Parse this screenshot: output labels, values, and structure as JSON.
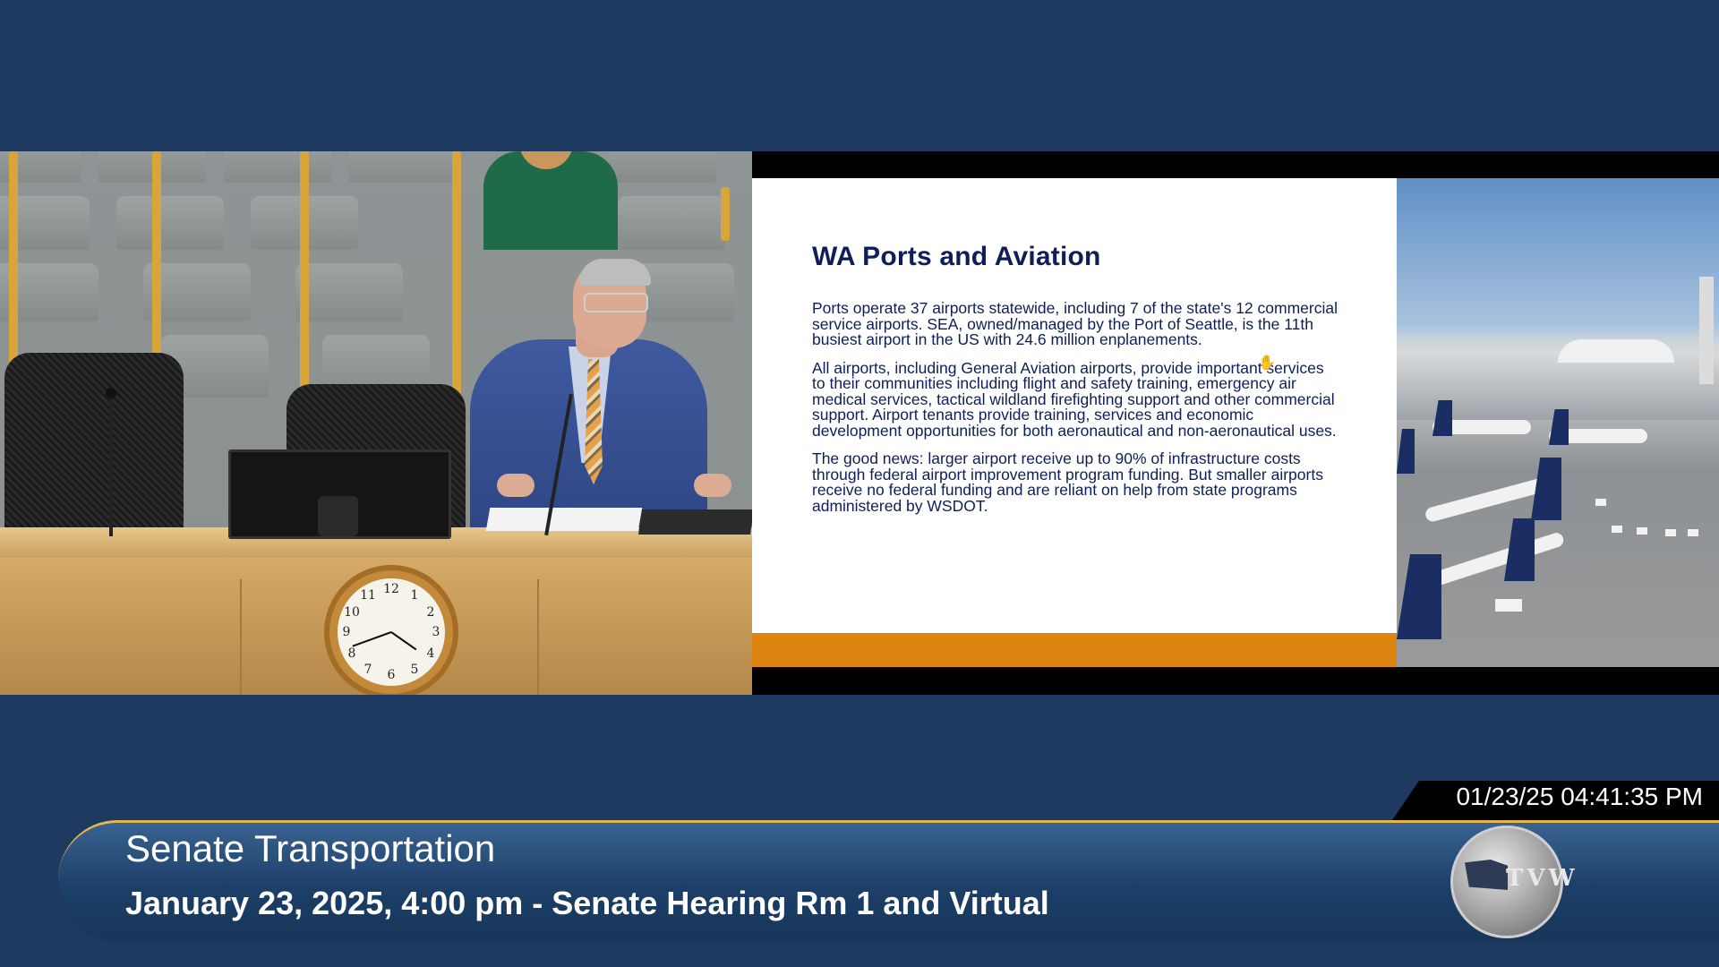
{
  "slide": {
    "title": "WA Ports and Aviation",
    "paragraphs": [
      "Ports operate 37 airports statewide, including 7 of the state's 12 commercial service airports. SEA, owned/managed by the Port of Seattle, is the 11th busiest airport in the US with 24.6 million enplanements.",
      "All airports, including General Aviation airports, provide important services to their communities including flight and safety training, emergency air medical services, tactical wildland firefighting support and other commercial support. Airport tenants provide training, services and economic development opportunities for both aeronautical and non-aeronautical uses.",
      "The good news: larger airport receive up to 90% of infrastructure costs through federal airport improvement program funding. But smaller airports receive no federal funding and are reliant on help from state programs administered by WSDOT."
    ]
  },
  "clock": {
    "numbers": [
      "12",
      "1",
      "2",
      "3",
      "4",
      "5",
      "6",
      "7",
      "8",
      "9",
      "10",
      "11"
    ]
  },
  "broadcast": {
    "timestamp": "01/23/25 04:41:35 PM",
    "program_title": "Senate Transportation",
    "program_subtitle": "January 23, 2025, 4:00 pm - Senate Hearing Rm 1 and Virtual",
    "logo_text": "TVW"
  },
  "colors": {
    "background": "#1e3a61",
    "slide_accent": "#dd8510",
    "slide_text": "#0f1e58",
    "lower_third_rule": "#e2b64a"
  }
}
